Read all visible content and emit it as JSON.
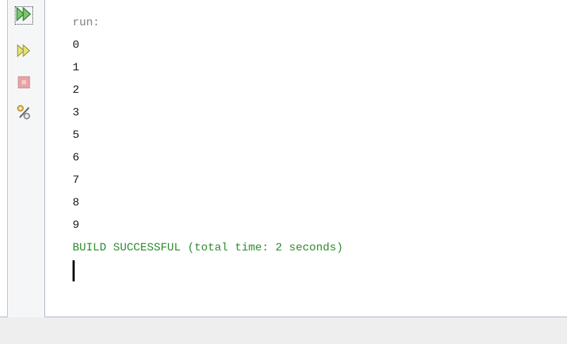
{
  "toolbar": {
    "items": [
      {
        "icon": "rerun-icon",
        "focused": true
      },
      {
        "icon": "rerun-with-different-parameters-icon",
        "focused": false
      },
      {
        "icon": "stop-icon",
        "focused": false
      },
      {
        "icon": "settings-icon",
        "focused": false
      }
    ]
  },
  "console": {
    "header": "run:",
    "lines": [
      "0",
      "1",
      "2",
      "3",
      "5",
      "6",
      "7",
      "8",
      "9"
    ],
    "status": "BUILD SUCCESSFUL (total time: 2 seconds)"
  },
  "colors": {
    "header_text": "#808080",
    "output_text": "#1a1a1a",
    "success_text": "#2e8b2e",
    "toolbar_bg": "#f5f6f8"
  }
}
